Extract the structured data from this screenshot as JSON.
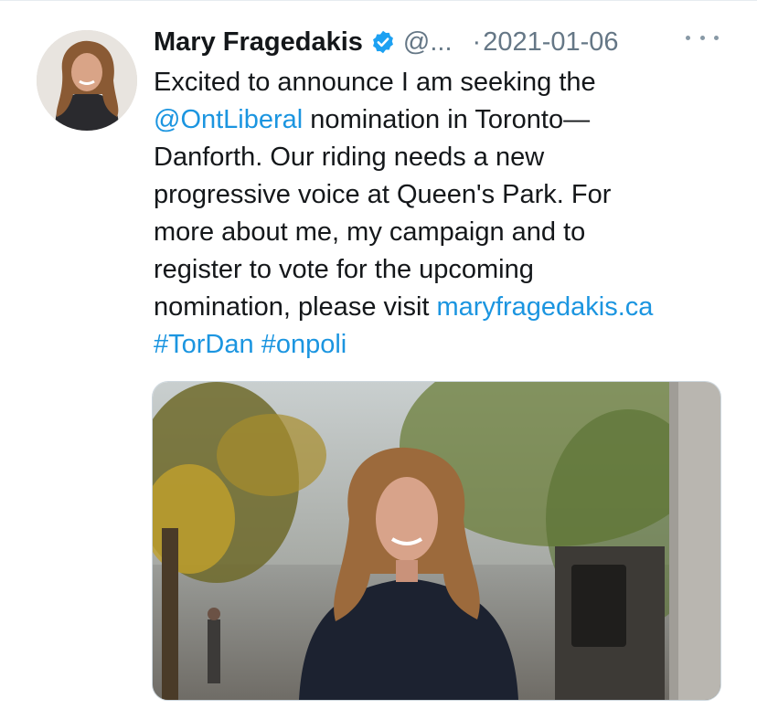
{
  "tweet": {
    "author_name": "Mary Fragedakis",
    "handle": "@...",
    "separator": "·",
    "date": "2021-01-06",
    "text_lines": [
      [
        {
          "t": "Excited to announce I am seeking the"
        }
      ],
      [
        {
          "t": "@OntLiberal",
          "link": true
        },
        {
          "t": " nomination in Toronto—"
        }
      ],
      [
        {
          "t": "Danforth. Our riding needs a new"
        }
      ],
      [
        {
          "t": "progressive voice at Queen's Park. For"
        }
      ],
      [
        {
          "t": "more about me, my campaign and to"
        }
      ],
      [
        {
          "t": "register to vote for the upcoming"
        }
      ],
      [
        {
          "t": "nomination, please visit "
        },
        {
          "t": "maryfragedakis.ca",
          "link": true
        }
      ],
      [
        {
          "t": "#TorDan",
          "link": true
        },
        {
          "t": " "
        },
        {
          "t": "#onpoli",
          "link": true
        }
      ]
    ]
  },
  "colors": {
    "link": "#1b95e0",
    "text": "#14171a",
    "secondary": "#657786",
    "verified": "#1da1f2"
  },
  "icons": {
    "verified": "verified-badge-icon",
    "more": "more-options-icon"
  }
}
